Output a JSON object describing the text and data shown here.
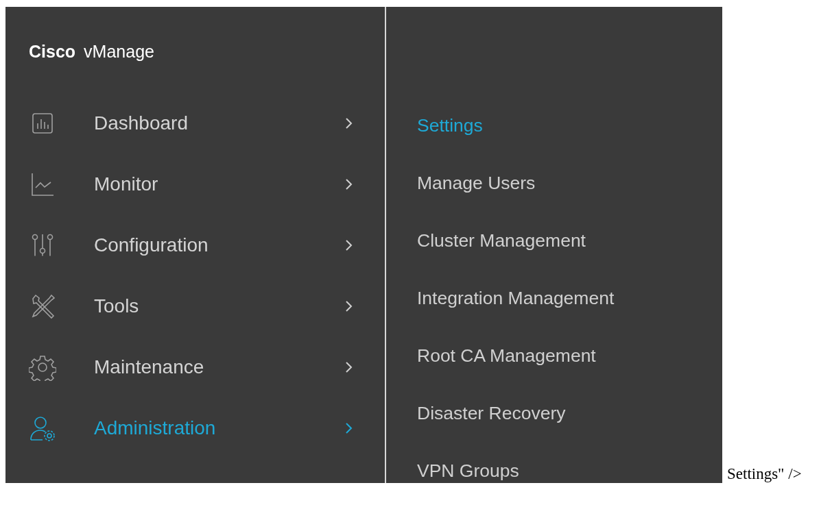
{
  "title": {
    "brand": "Cisco",
    "product": "vManage"
  },
  "menu": [
    {
      "label": "Dashboard",
      "selected": false
    },
    {
      "label": "Monitor",
      "selected": false
    },
    {
      "label": "Configuration",
      "selected": false
    },
    {
      "label": "Tools",
      "selected": false
    },
    {
      "label": "Maintenance",
      "selected": false
    },
    {
      "label": "Administration",
      "selected": true
    }
  ],
  "submenu": [
    {
      "label": "Settings",
      "selected": true
    },
    {
      "label": "Manage Users",
      "selected": false
    },
    {
      "label": "Cluster Management",
      "selected": false
    },
    {
      "label": "Integration Management",
      "selected": false
    },
    {
      "label": "Root CA Management",
      "selected": false
    },
    {
      "label": "Disaster Recovery",
      "selected": false
    },
    {
      "label": "VPN Groups",
      "selected": false
    }
  ],
  "trailing_text": "Settings\" />"
}
